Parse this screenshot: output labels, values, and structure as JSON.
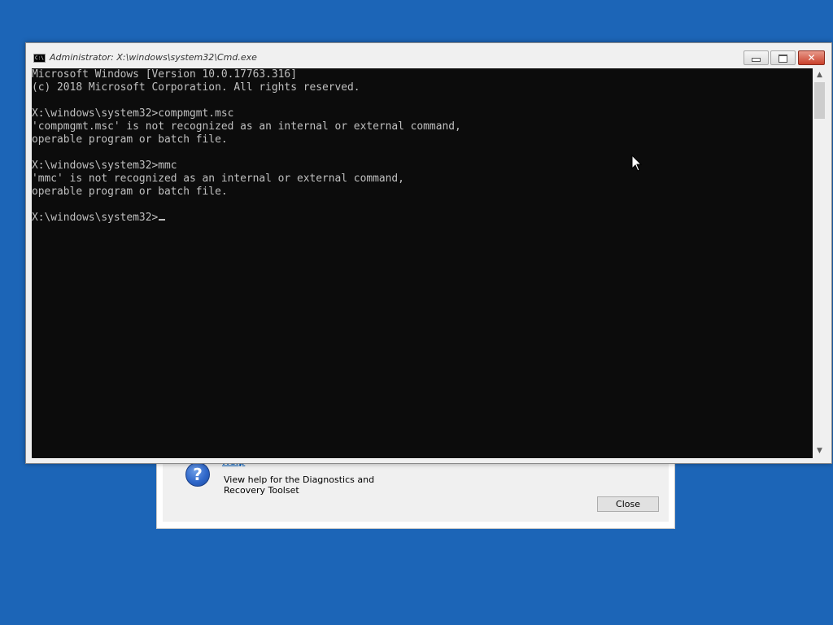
{
  "dart_dialog": {
    "help_icon_glyph": "?",
    "help_link": "Help",
    "help_description": "View help for the Diagnostics and Recovery Toolset",
    "close_label": "Close"
  },
  "cmd_window": {
    "title": "Administrator: X:\\windows\\system32\\Cmd.exe",
    "icon_text": "C:\\",
    "buttons": {
      "minimize": "minimize",
      "maximize": "maximize",
      "close": "✕"
    },
    "console_lines": [
      "Microsoft Windows [Version 10.0.17763.316]",
      "(c) 2018 Microsoft Corporation. All rights reserved.",
      "",
      "X:\\windows\\system32>compmgmt.msc",
      "'compmgmt.msc' is not recognized as an internal or external command,",
      "operable program or batch file.",
      "",
      "X:\\windows\\system32>mmc",
      "'mmc' is not recognized as an internal or external command,",
      "operable program or batch file.",
      "",
      "X:\\windows\\system32>"
    ],
    "scrollbar": {
      "up_arrow": "▲",
      "down_arrow": "▼"
    }
  },
  "colors": {
    "desktop_background": "#1c65b7",
    "console_background": "#0c0c0c",
    "console_text": "#c0c0c0",
    "close_button": "#c9412b"
  }
}
